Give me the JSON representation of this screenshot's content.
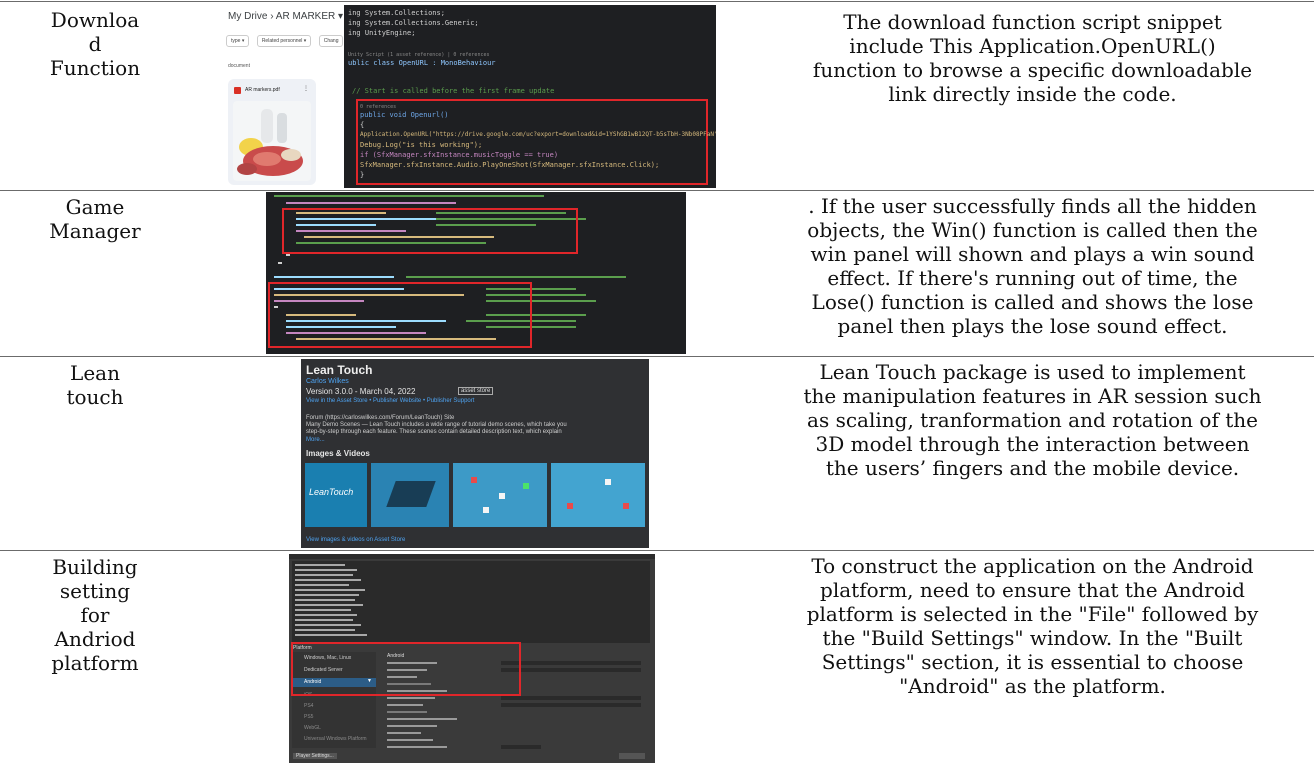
{
  "rows": [
    {
      "label_lines": [
        "Downloa",
        "d",
        "Function"
      ],
      "description_lines": [
        "The download function script snippet",
        "include This Application.OpenURL()",
        "function to browse a specific downloadable",
        "link directly inside the code."
      ],
      "screenshot": {
        "drive_path": "My Drive  ›  AR MARKER ▾",
        "filters": [
          "type ▾",
          "Related personnel ▾",
          "Chang"
        ],
        "section": "document",
        "file_name": "AR markers.pdf",
        "code_lines": [
          "ing System.Collections;",
          "ing System.Collections.Generic;",
          "ing UnityEngine;",
          "",
          "Unity Script (1 asset reference) | 0 references",
          "ublic class OpenURL : MonoBehaviour",
          "",
          "  // Start is called before the first frame update",
          "0 references",
          "public void Openurl()",
          "{",
          "    Application.OpenURL(\"https://drive.google.com/uc?export=download&id=1YShGB1wB12QT-b5sTbH-3Nb08PFaN\");",
          "    Debug.Log(\"is this working\");",
          "    if (SfxManager.sfxInstance.musicToggle == true)",
          "        SfxManager.sfxInstance.Audio.PlayOneShot(SfxManager.sfxInstance.Click);",
          "}"
        ]
      }
    },
    {
      "label_lines": [
        "Game",
        "Manager"
      ],
      "description_lines": [
        ". If the user successfully finds all the hidden",
        "objects, the Win() function is called then the",
        "win panel will shown and plays a win sound",
        "effect. If there's running out of time, the",
        "Lose() function is called and shows the lose",
        "panel then plays the lose sound effect."
      ]
    },
    {
      "label_lines": [
        "Lean",
        "touch"
      ],
      "description_lines": [
        "Lean Touch package is used to implement",
        "the manipulation features in AR session such",
        "as scaling, tranformation and rotation of the",
        "3D model through the interaction between",
        "the users’ fingers and the mobile device."
      ],
      "screenshot": {
        "title": "Lean Touch",
        "author": "Carlos Wilkes",
        "version": "Version 3.0.0 - March 04, 2022",
        "badge": "asset store",
        "links": "View in the Asset Store  •  Publisher Website  •  Publisher Support",
        "forum": "Forum (https://carloswilkes.com/Forum/LeanTouch)    Site",
        "blurb": [
          "Many Demo Scenes — Lean Touch includes a wide range of tutorial demo scenes, which take you",
          "step-by-step through each feature. These scenes contain detailed description text, which explain"
        ],
        "more": "More...",
        "images_heading": "Images & Videos",
        "logo_text": "LeanTouch",
        "footer_link": "View images & videos on Asset Store"
      }
    },
    {
      "label_lines": [
        "Building",
        "setting",
        "for",
        "Andriod",
        "platform"
      ],
      "description_lines": [
        "To construct the application on the Android",
        "platform, need to ensure that the Android",
        "platform is selected in the \"File\" followed by",
        "the \"Build Settings\" window. In the \"Built",
        "Settings\" section, it is essential to choose",
        "\"Android\" as the platform."
      ],
      "screenshot": {
        "platforms_heading": "Platform",
        "platforms": [
          "Windows, Mac, Linux",
          "Dedicated Server",
          "Android",
          "iOS",
          "PS4",
          "PS5",
          "WebGL",
          "Universal Windows Platform"
        ],
        "selected_platform": "Android",
        "settings_heading": "Android",
        "player_settings": "Player Settings..."
      }
    }
  ]
}
